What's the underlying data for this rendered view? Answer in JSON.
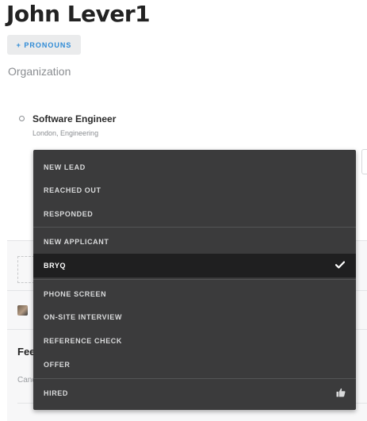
{
  "candidate": {
    "name": "John Lever1",
    "pronouns_button": "+ PRONOUNS",
    "organization_placeholder": "Organization"
  },
  "opportunity": {
    "job_title": "Software Engineer",
    "job_subtitle": "London, Engineering"
  },
  "feedback": {
    "label": "Fee",
    "candidate_label": "Canc"
  },
  "stage_menu": {
    "selected": "BRYQ",
    "groups": [
      [
        "NEW LEAD",
        "REACHED OUT",
        "RESPONDED"
      ],
      [
        "NEW APPLICANT",
        "BRYQ"
      ],
      [
        "PHONE SCREEN",
        "ON-SITE INTERVIEW",
        "REFERENCE CHECK",
        "OFFER"
      ],
      [
        "HIRED"
      ]
    ],
    "items": {
      "new_lead": "NEW LEAD",
      "reached_out": "REACHED OUT",
      "responded": "RESPONDED",
      "new_applicant": "NEW APPLICANT",
      "bryq": "BRYQ",
      "phone_screen": "PHONE SCREEN",
      "onsite_interview": "ON-SITE INTERVIEW",
      "reference_check": "REFERENCE CHECK",
      "offer": "OFFER",
      "hired": "HIRED"
    }
  },
  "icons": {
    "selected_marker": "checkmark-icon",
    "hired_marker": "thumbs-up-icon",
    "status_dot": "circle-outline-icon"
  },
  "colors": {
    "accent": "#2f8bd6",
    "menu_bg": "#3b3b3c",
    "menu_selected_bg": "#1f1f20",
    "muted_text": "#8a8d91"
  }
}
